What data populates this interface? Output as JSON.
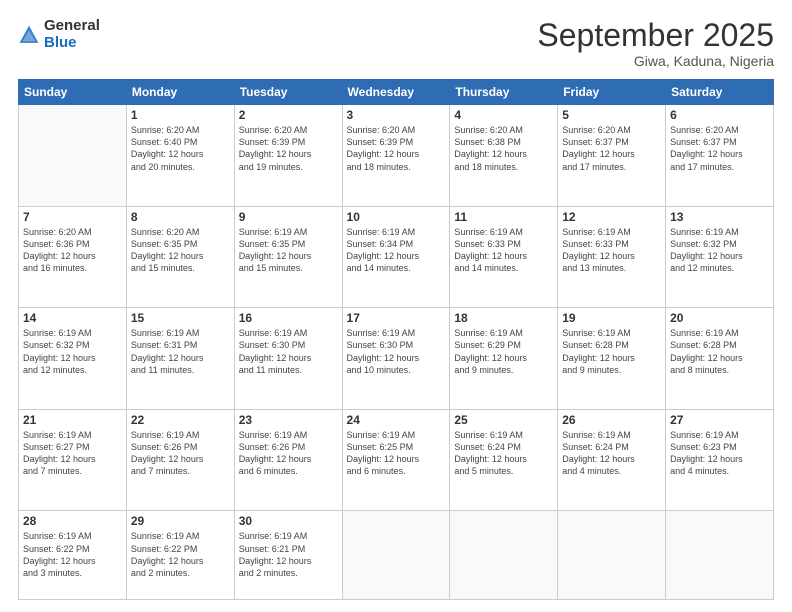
{
  "logo": {
    "general": "General",
    "blue": "Blue"
  },
  "header": {
    "month": "September 2025",
    "location": "Giwa, Kaduna, Nigeria"
  },
  "days_of_week": [
    "Sunday",
    "Monday",
    "Tuesday",
    "Wednesday",
    "Thursday",
    "Friday",
    "Saturday"
  ],
  "weeks": [
    [
      {
        "day": "",
        "info": ""
      },
      {
        "day": "1",
        "info": "Sunrise: 6:20 AM\nSunset: 6:40 PM\nDaylight: 12 hours\nand 20 minutes."
      },
      {
        "day": "2",
        "info": "Sunrise: 6:20 AM\nSunset: 6:39 PM\nDaylight: 12 hours\nand 19 minutes."
      },
      {
        "day": "3",
        "info": "Sunrise: 6:20 AM\nSunset: 6:39 PM\nDaylight: 12 hours\nand 18 minutes."
      },
      {
        "day": "4",
        "info": "Sunrise: 6:20 AM\nSunset: 6:38 PM\nDaylight: 12 hours\nand 18 minutes."
      },
      {
        "day": "5",
        "info": "Sunrise: 6:20 AM\nSunset: 6:37 PM\nDaylight: 12 hours\nand 17 minutes."
      },
      {
        "day": "6",
        "info": "Sunrise: 6:20 AM\nSunset: 6:37 PM\nDaylight: 12 hours\nand 17 minutes."
      }
    ],
    [
      {
        "day": "7",
        "info": "Sunrise: 6:20 AM\nSunset: 6:36 PM\nDaylight: 12 hours\nand 16 minutes."
      },
      {
        "day": "8",
        "info": "Sunrise: 6:20 AM\nSunset: 6:35 PM\nDaylight: 12 hours\nand 15 minutes."
      },
      {
        "day": "9",
        "info": "Sunrise: 6:19 AM\nSunset: 6:35 PM\nDaylight: 12 hours\nand 15 minutes."
      },
      {
        "day": "10",
        "info": "Sunrise: 6:19 AM\nSunset: 6:34 PM\nDaylight: 12 hours\nand 14 minutes."
      },
      {
        "day": "11",
        "info": "Sunrise: 6:19 AM\nSunset: 6:33 PM\nDaylight: 12 hours\nand 14 minutes."
      },
      {
        "day": "12",
        "info": "Sunrise: 6:19 AM\nSunset: 6:33 PM\nDaylight: 12 hours\nand 13 minutes."
      },
      {
        "day": "13",
        "info": "Sunrise: 6:19 AM\nSunset: 6:32 PM\nDaylight: 12 hours\nand 12 minutes."
      }
    ],
    [
      {
        "day": "14",
        "info": "Sunrise: 6:19 AM\nSunset: 6:32 PM\nDaylight: 12 hours\nand 12 minutes."
      },
      {
        "day": "15",
        "info": "Sunrise: 6:19 AM\nSunset: 6:31 PM\nDaylight: 12 hours\nand 11 minutes."
      },
      {
        "day": "16",
        "info": "Sunrise: 6:19 AM\nSunset: 6:30 PM\nDaylight: 12 hours\nand 11 minutes."
      },
      {
        "day": "17",
        "info": "Sunrise: 6:19 AM\nSunset: 6:30 PM\nDaylight: 12 hours\nand 10 minutes."
      },
      {
        "day": "18",
        "info": "Sunrise: 6:19 AM\nSunset: 6:29 PM\nDaylight: 12 hours\nand 9 minutes."
      },
      {
        "day": "19",
        "info": "Sunrise: 6:19 AM\nSunset: 6:28 PM\nDaylight: 12 hours\nand 9 minutes."
      },
      {
        "day": "20",
        "info": "Sunrise: 6:19 AM\nSunset: 6:28 PM\nDaylight: 12 hours\nand 8 minutes."
      }
    ],
    [
      {
        "day": "21",
        "info": "Sunrise: 6:19 AM\nSunset: 6:27 PM\nDaylight: 12 hours\nand 7 minutes."
      },
      {
        "day": "22",
        "info": "Sunrise: 6:19 AM\nSunset: 6:26 PM\nDaylight: 12 hours\nand 7 minutes."
      },
      {
        "day": "23",
        "info": "Sunrise: 6:19 AM\nSunset: 6:26 PM\nDaylight: 12 hours\nand 6 minutes."
      },
      {
        "day": "24",
        "info": "Sunrise: 6:19 AM\nSunset: 6:25 PM\nDaylight: 12 hours\nand 6 minutes."
      },
      {
        "day": "25",
        "info": "Sunrise: 6:19 AM\nSunset: 6:24 PM\nDaylight: 12 hours\nand 5 minutes."
      },
      {
        "day": "26",
        "info": "Sunrise: 6:19 AM\nSunset: 6:24 PM\nDaylight: 12 hours\nand 4 minutes."
      },
      {
        "day": "27",
        "info": "Sunrise: 6:19 AM\nSunset: 6:23 PM\nDaylight: 12 hours\nand 4 minutes."
      }
    ],
    [
      {
        "day": "28",
        "info": "Sunrise: 6:19 AM\nSunset: 6:22 PM\nDaylight: 12 hours\nand 3 minutes."
      },
      {
        "day": "29",
        "info": "Sunrise: 6:19 AM\nSunset: 6:22 PM\nDaylight: 12 hours\nand 2 minutes."
      },
      {
        "day": "30",
        "info": "Sunrise: 6:19 AM\nSunset: 6:21 PM\nDaylight: 12 hours\nand 2 minutes."
      },
      {
        "day": "",
        "info": ""
      },
      {
        "day": "",
        "info": ""
      },
      {
        "day": "",
        "info": ""
      },
      {
        "day": "",
        "info": ""
      }
    ]
  ]
}
